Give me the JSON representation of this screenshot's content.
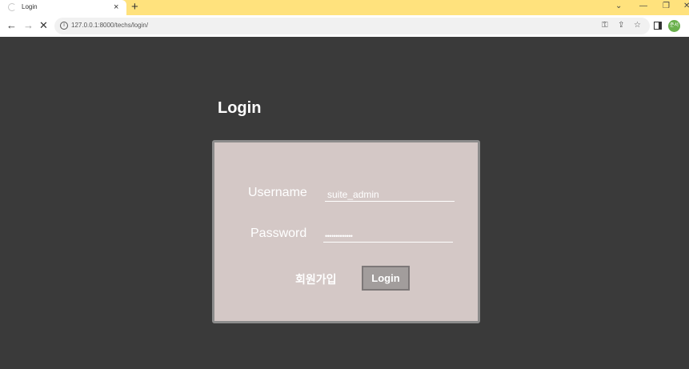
{
  "browser": {
    "tab_title": "Login",
    "new_tab_label": "+",
    "tab_close_label": "×",
    "url": "127.0.0.1:8000/techs/login/",
    "profile_initials": "준서"
  },
  "page": {
    "title": "Login",
    "username_label": "Username",
    "username_value": "suite_admin",
    "password_label": "Password",
    "password_mask": "•••••••••••••",
    "signup_label": "회원가입",
    "login_button_label": "Login"
  }
}
